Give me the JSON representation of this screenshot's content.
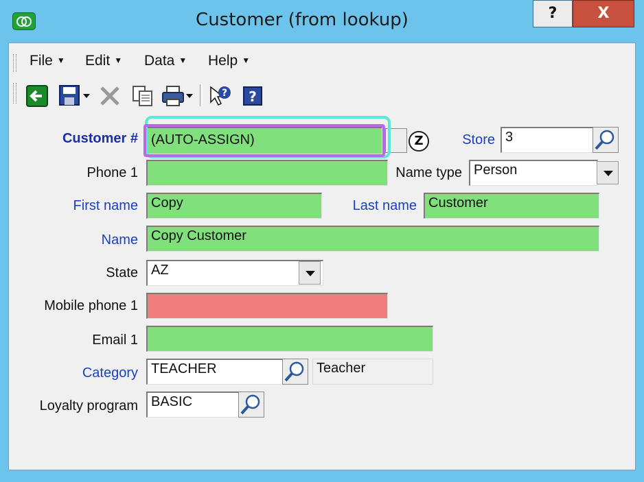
{
  "window": {
    "title": "Customer (from lookup)",
    "help_label": "?",
    "close_label": "X"
  },
  "menu": [
    {
      "label": "File"
    },
    {
      "label": "Edit"
    },
    {
      "label": "Data"
    },
    {
      "label": "Help"
    }
  ],
  "toolbar": {
    "icons": [
      "exit-icon",
      "save-icon",
      "delete-icon",
      "copy-icon",
      "print-icon",
      "context-help-icon",
      "help-icon"
    ]
  },
  "form": {
    "customer_no": {
      "label": "Customer #",
      "value": "(AUTO-ASSIGN)"
    },
    "store": {
      "label": "Store",
      "value": "3"
    },
    "phone1": {
      "label": "Phone 1",
      "value": ""
    },
    "name_type": {
      "label": "Name type",
      "value": "Person"
    },
    "first_name": {
      "label": "First name",
      "value": "Copy"
    },
    "last_name": {
      "label": "Last name",
      "value": "Customer"
    },
    "name": {
      "label": "Name",
      "value": "Copy Customer"
    },
    "state": {
      "label": "State",
      "value": "AZ"
    },
    "mobile_phone1": {
      "label": "Mobile phone 1",
      "value": ""
    },
    "email1": {
      "label": "Email 1",
      "value": ""
    },
    "category": {
      "label": "Category",
      "value": "TEACHER",
      "description": "Teacher"
    },
    "loyalty_program": {
      "label": "Loyalty program",
      "value": "BASIC"
    },
    "z_label": "Z"
  },
  "colors": {
    "required": "#80e07c",
    "invalid": "#f07e7c",
    "frame": "#6cc4ec"
  }
}
